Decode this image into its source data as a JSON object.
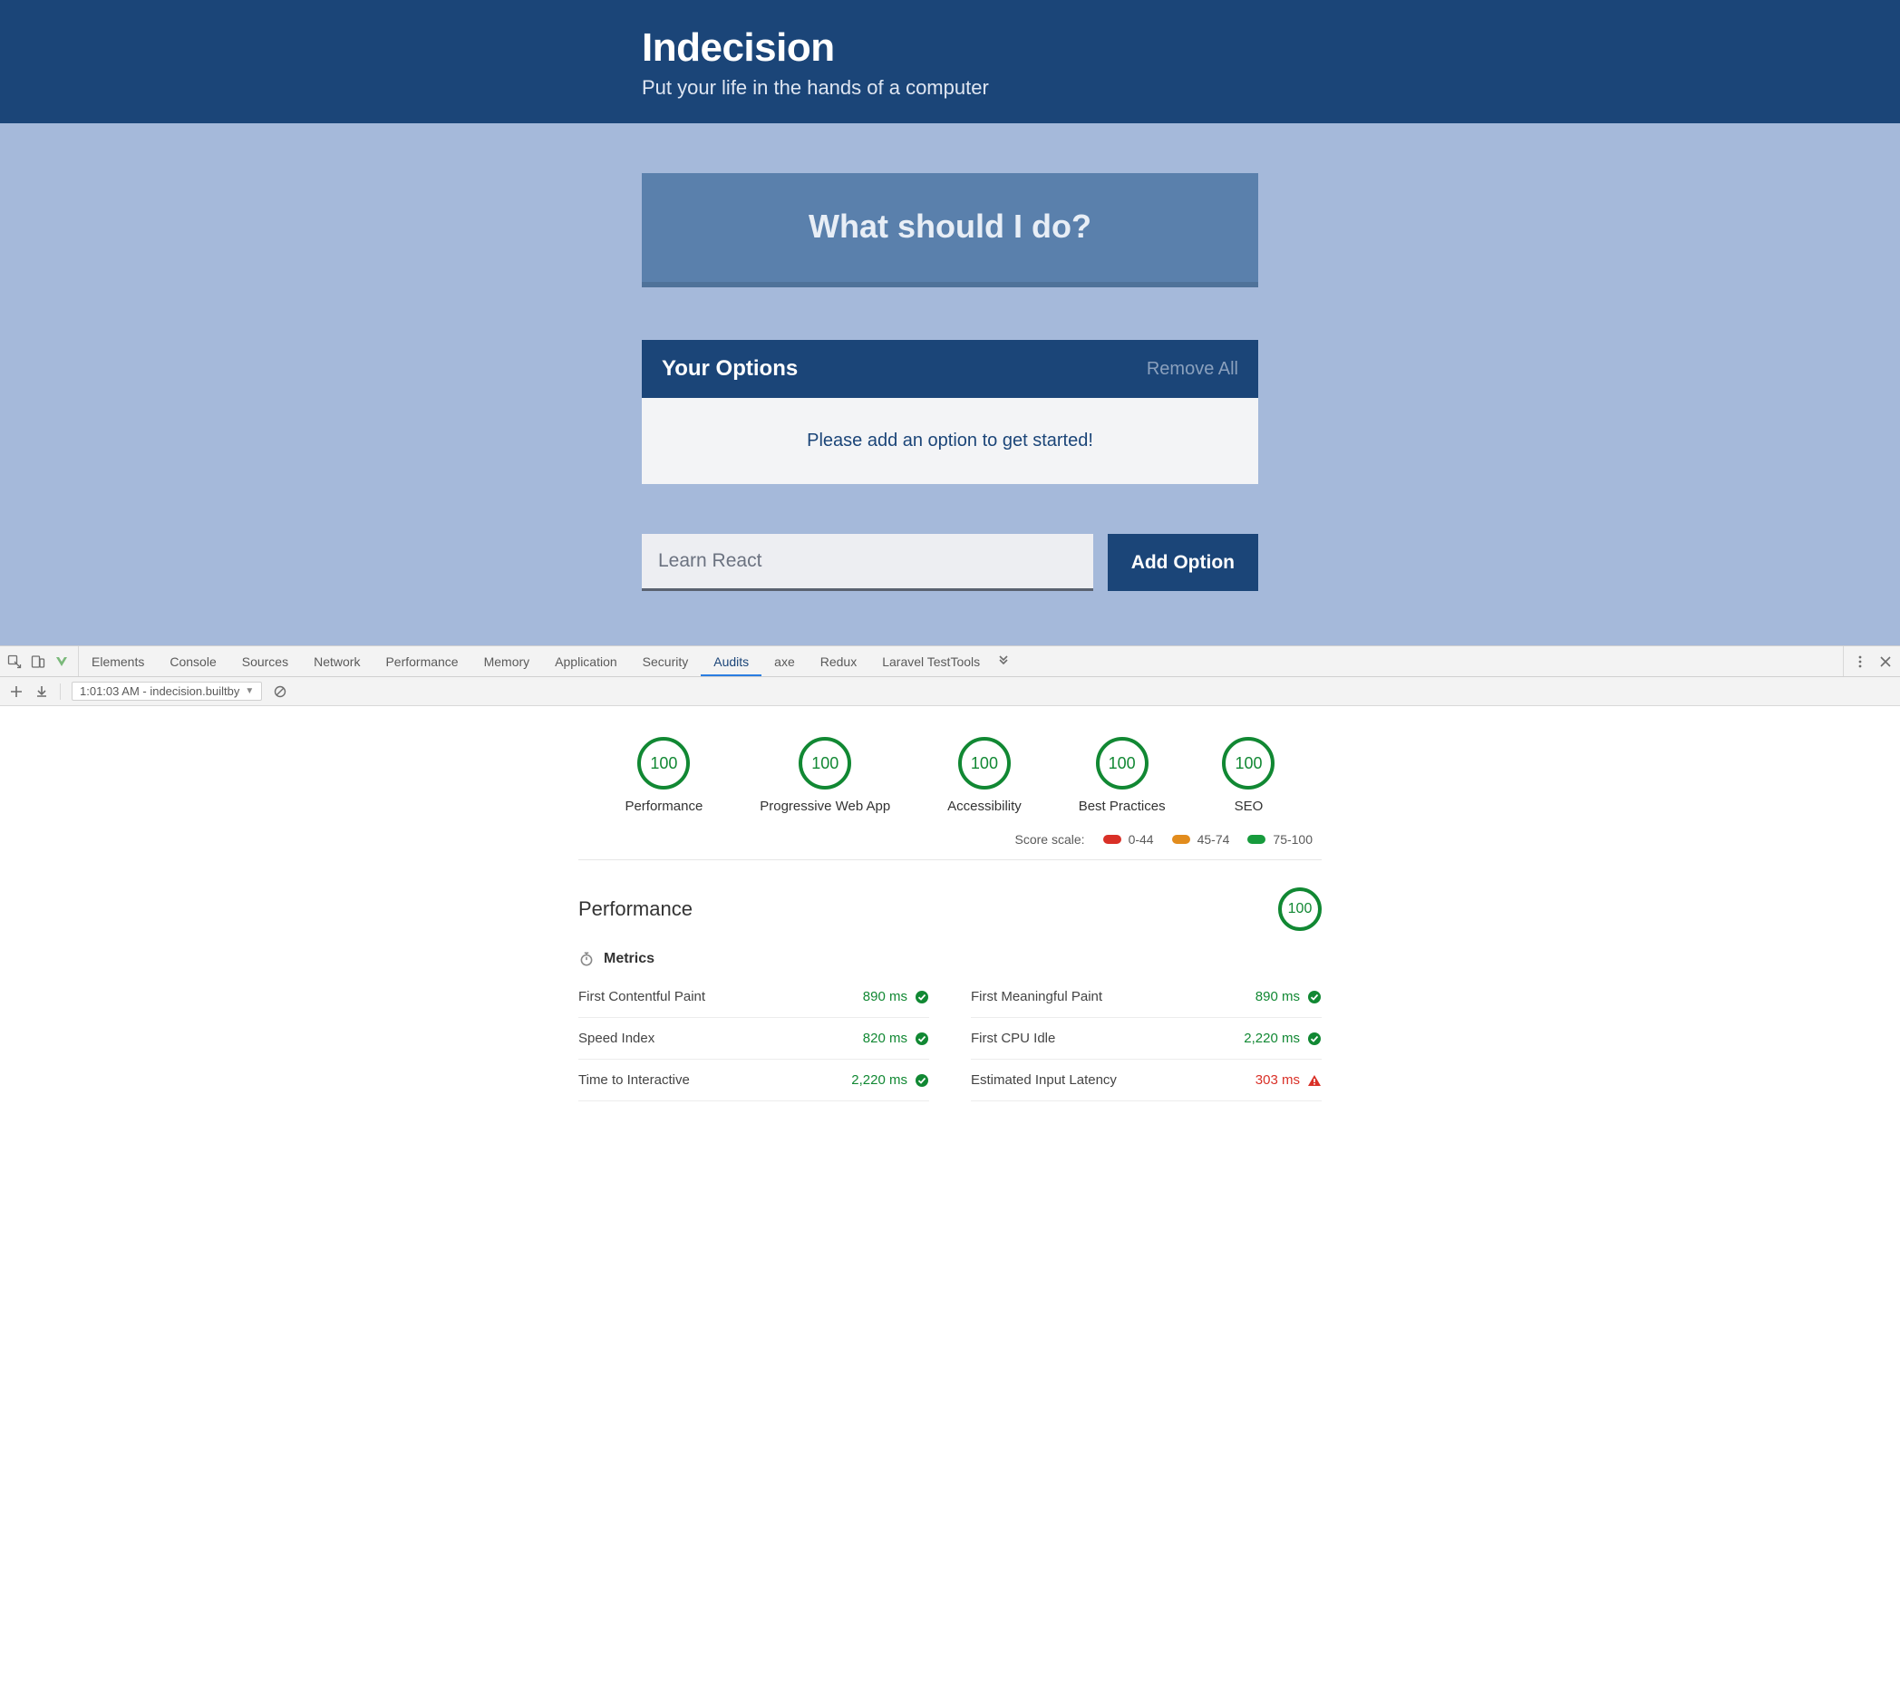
{
  "app": {
    "title": "Indecision",
    "subtitle": "Put your life in the hands of a computer",
    "main_button": "What should I do?",
    "options_header": "Your Options",
    "remove_all": "Remove All",
    "empty_msg": "Please add an option to get started!",
    "input_placeholder": "Learn React",
    "add_button": "Add Option"
  },
  "devtools": {
    "tabs": {
      "elements": "Elements",
      "console": "Console",
      "sources": "Sources",
      "network": "Network",
      "performance": "Performance",
      "memory": "Memory",
      "application": "Application",
      "security": "Security",
      "audits": "Audits",
      "axe": "axe",
      "redux": "Redux",
      "laravel": "Laravel TestTools"
    },
    "timestamp": "1:01:03 AM - indecision.builtby"
  },
  "audit": {
    "scores": {
      "performance": {
        "value": "100",
        "label": "Performance"
      },
      "pwa": {
        "value": "100",
        "label": "Progressive Web App"
      },
      "accessibility": {
        "value": "100",
        "label": "Accessibility"
      },
      "best": {
        "value": "100",
        "label": "Best Practices"
      },
      "seo": {
        "value": "100",
        "label": "SEO"
      }
    },
    "scale": {
      "label": "Score scale:",
      "r0": "0-44",
      "r1": "45-74",
      "r2": "75-100"
    },
    "perf": {
      "title": "Performance",
      "score": "100",
      "metrics_title": "Metrics",
      "metrics": {
        "fcp": {
          "name": "First Contentful Paint",
          "value": "890 ms",
          "status": "green"
        },
        "si": {
          "name": "Speed Index",
          "value": "820 ms",
          "status": "green"
        },
        "tti": {
          "name": "Time to Interactive",
          "value": "2,220 ms",
          "status": "green"
        },
        "fmp": {
          "name": "First Meaningful Paint",
          "value": "890 ms",
          "status": "green"
        },
        "fci": {
          "name": "First CPU Idle",
          "value": "2,220 ms",
          "status": "green"
        },
        "eil": {
          "name": "Estimated Input Latency",
          "value": "303 ms",
          "status": "red"
        }
      }
    }
  }
}
